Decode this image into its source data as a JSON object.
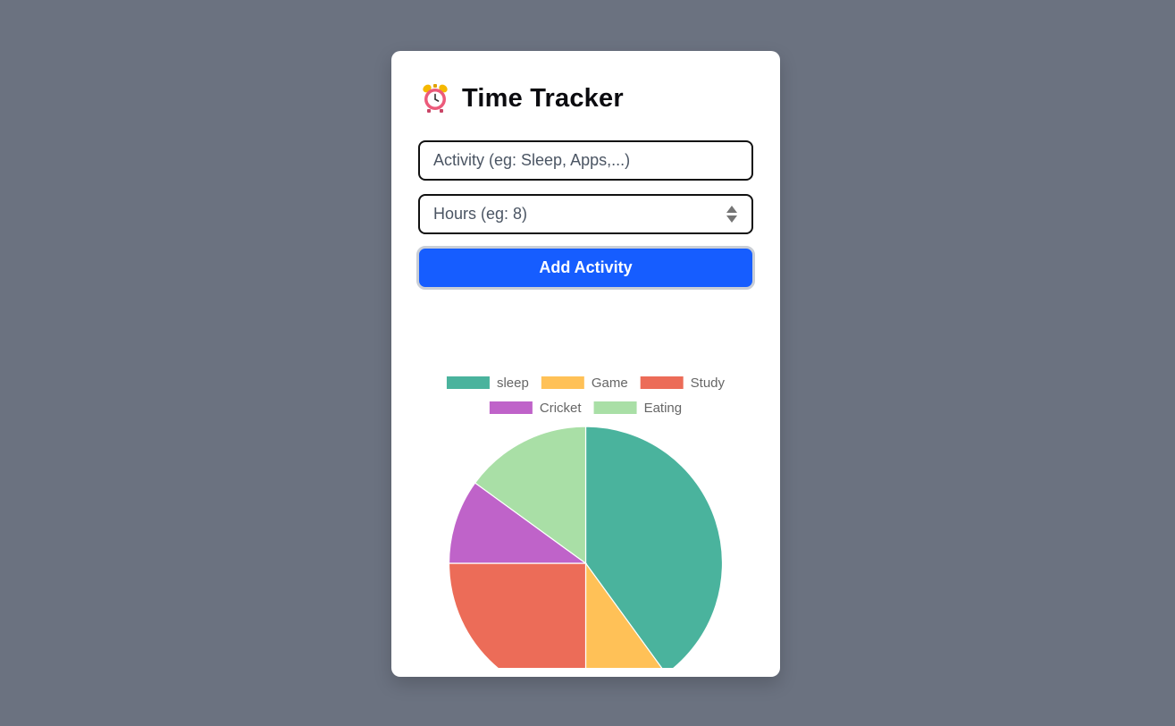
{
  "app": {
    "title": "Time Tracker",
    "icon": "alarm-clock-icon"
  },
  "form": {
    "activity_placeholder": "Activity (eg: Sleep, Apps,...)",
    "activity_value": "",
    "hours_placeholder": "Hours (eg: 8)",
    "hours_value": "",
    "add_button_label": "Add Activity"
  },
  "colors": {
    "page_background": "#6b7280",
    "card_background": "#ffffff",
    "button_primary": "#165dff"
  },
  "chart_data": {
    "type": "pie",
    "title": "",
    "legend_position": "top",
    "categories": [
      "sleep",
      "Game",
      "Study",
      "Cricket",
      "Eating"
    ],
    "values": [
      8,
      2,
      5,
      2,
      3
    ],
    "colors": [
      "#4ab39d",
      "#ffc157",
      "#ec6c58",
      "#bf63c9",
      "#a9dfa6"
    ]
  }
}
